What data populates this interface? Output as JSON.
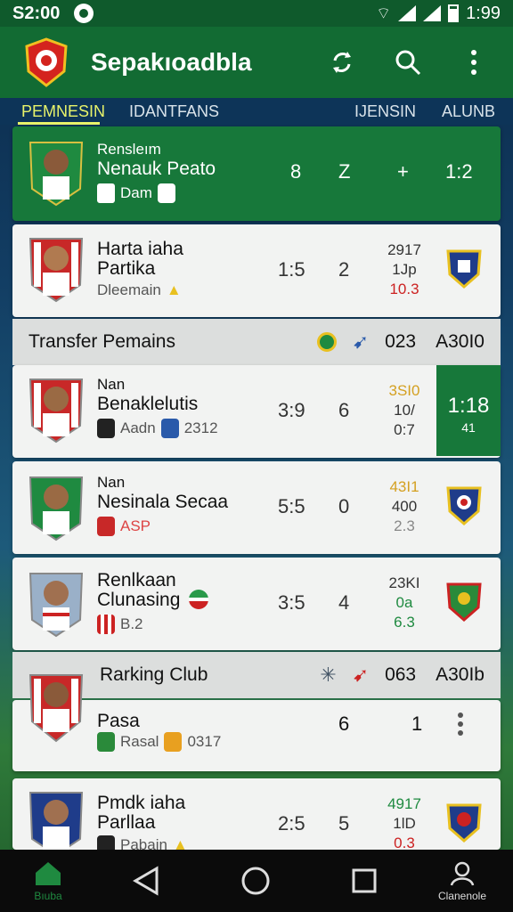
{
  "status_bar": {
    "time": "S2:00",
    "right_time": "1:99"
  },
  "app": {
    "title": "Sepakıoadbla"
  },
  "tabs": [
    "PEMNESIN",
    "IDANTFANS",
    "IJENSIN",
    "ALUNB"
  ],
  "featured": {
    "small_name": "Rensleım",
    "big_name": "Nenauk Peato",
    "meta_label": "Dam",
    "stats": [
      "8",
      "Z",
      "+",
      "1:2"
    ]
  },
  "rows": [
    {
      "small_name": "Harta iaha",
      "big_name": "Partika",
      "meta": "Dleemain",
      "score": "1:5",
      "count": "2",
      "col": [
        "2917",
        "1Jp",
        "10.3"
      ]
    }
  ],
  "section1": {
    "title": "Transfer Pemains",
    "value1": "023",
    "value2": "A30I0"
  },
  "rows2": [
    {
      "small_name": "Nan",
      "big_name": "Benaklelutis",
      "meta1": "Aadn",
      "meta2": "2312",
      "score": "3:9",
      "count": "6",
      "col": [
        "3SI0",
        "10/",
        "0:7"
      ],
      "highlight_main": "1:18",
      "highlight_sub": "41"
    },
    {
      "small_name": "Nan",
      "big_name": "Nesinala Secaa",
      "meta": "ASP",
      "score": "5:5",
      "count": "0",
      "col": [
        "43I1",
        "400",
        "2.3"
      ]
    },
    {
      "small_name": "Renlkaan",
      "big_name": "Clunasing",
      "meta": "B.2",
      "score": "3:5",
      "count": "4",
      "col": [
        "23KI",
        "0a",
        "6.3"
      ]
    }
  ],
  "section2": {
    "title": "Rarking Club",
    "value1": "063",
    "value2": "A30Ib"
  },
  "rows3": [
    {
      "big_name": "Pasa",
      "meta1": "Rasal",
      "meta2": "0317",
      "count": "6",
      "count2": "1"
    },
    {
      "small_name": "Pmdk iaha",
      "big_name": "Parllaa",
      "meta": "Pabain",
      "score": "2:5",
      "count": "5",
      "col": [
        "4917",
        "1lD",
        "0.3"
      ]
    }
  ],
  "nav": {
    "home_label": "Bıuba",
    "profile_label": "Clanenole"
  },
  "colors": {
    "primary": "#17783a",
    "appbar": "#126b33",
    "accent": "#e8f36a"
  }
}
